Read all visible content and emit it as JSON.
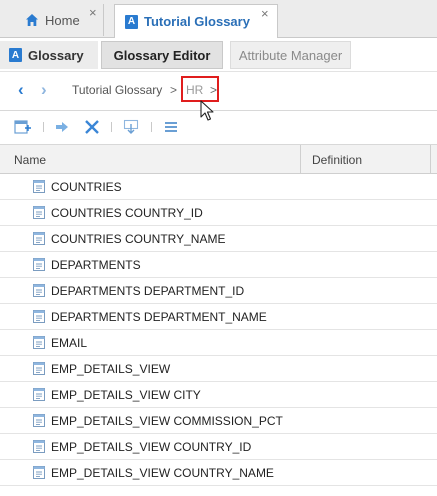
{
  "top_tabs": [
    {
      "label": "Home",
      "close": "×"
    },
    {
      "label": "Tutorial Glossary",
      "close": "×"
    }
  ],
  "sub_tabs": {
    "glossary": "Glossary",
    "editor": "Glossary Editor",
    "attribute_manager": "Attribute Manager"
  },
  "badge_letter": "A",
  "breadcrumb": {
    "back": "‹",
    "forward": "›",
    "items": [
      "Tutorial Glossary",
      "HR"
    ],
    "separator": ">"
  },
  "table": {
    "columns": [
      "Name",
      "Definition"
    ],
    "rows": [
      "COUNTRIES",
      "COUNTRIES COUNTRY_ID",
      "COUNTRIES COUNTRY_NAME",
      "DEPARTMENTS",
      "DEPARTMENTS DEPARTMENT_ID",
      "DEPARTMENTS DEPARTMENT_NAME",
      "EMAIL",
      "EMP_DETAILS_VIEW",
      "EMP_DETAILS_VIEW CITY",
      "EMP_DETAILS_VIEW COMMISSION_PCT",
      "EMP_DETAILS_VIEW COUNTRY_ID",
      "EMP_DETAILS_VIEW COUNTRY_NAME"
    ]
  },
  "colors": {
    "accent": "#2a7bd0",
    "highlight": "#e01d1d"
  },
  "icons": [
    "home-icon",
    "glossary-badge-icon",
    "new-term-icon",
    "move-icon",
    "delete-icon",
    "import-icon",
    "menu-icon",
    "term-icon",
    "cursor-icon"
  ]
}
